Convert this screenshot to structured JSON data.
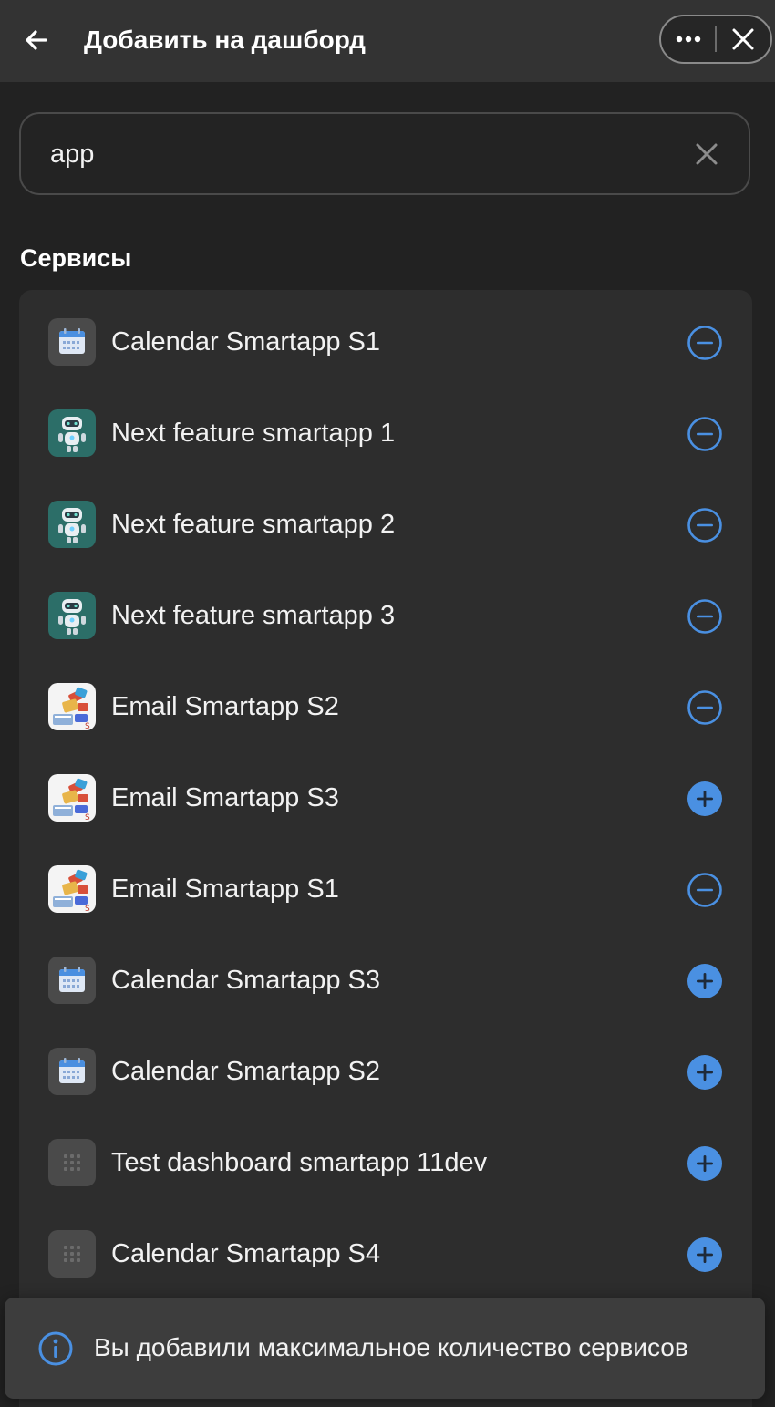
{
  "header": {
    "title": "Добавить на дашборд"
  },
  "search": {
    "value": "app"
  },
  "section": {
    "title": "Сервисы"
  },
  "colors": {
    "accent": "#4a90e2",
    "background": "#222222",
    "header_bg": "#333333",
    "card_bg": "#2d2d2d",
    "robot_icon_bg": "#2c6e68"
  },
  "services": [
    {
      "label": "Calendar Smartapp S1",
      "icon": "calendar-icon",
      "action": "remove"
    },
    {
      "label": "Next feature smartapp 1",
      "icon": "robot-icon",
      "action": "remove"
    },
    {
      "label": "Next feature smartapp 2",
      "icon": "robot-icon",
      "action": "remove"
    },
    {
      "label": "Next feature smartapp 3",
      "icon": "robot-icon",
      "action": "remove"
    },
    {
      "label": "Email Smartapp S2",
      "icon": "email-app-icon",
      "action": "remove"
    },
    {
      "label": "Email Smartapp S3",
      "icon": "email-app-icon",
      "action": "add"
    },
    {
      "label": "Email Smartapp S1",
      "icon": "email-app-icon",
      "action": "remove"
    },
    {
      "label": "Calendar Smartapp S3",
      "icon": "calendar-icon",
      "action": "add"
    },
    {
      "label": "Calendar Smartapp S2",
      "icon": "calendar-icon",
      "action": "add"
    },
    {
      "label": "Test dashboard smartapp 11dev",
      "icon": "app-grid-icon",
      "action": "add"
    },
    {
      "label": "Calendar Smartapp S4",
      "icon": "app-grid-icon",
      "action": "add"
    }
  ],
  "toast": {
    "text": "Вы добавили максимальное количество сервисов",
    "icon": "info-icon"
  }
}
